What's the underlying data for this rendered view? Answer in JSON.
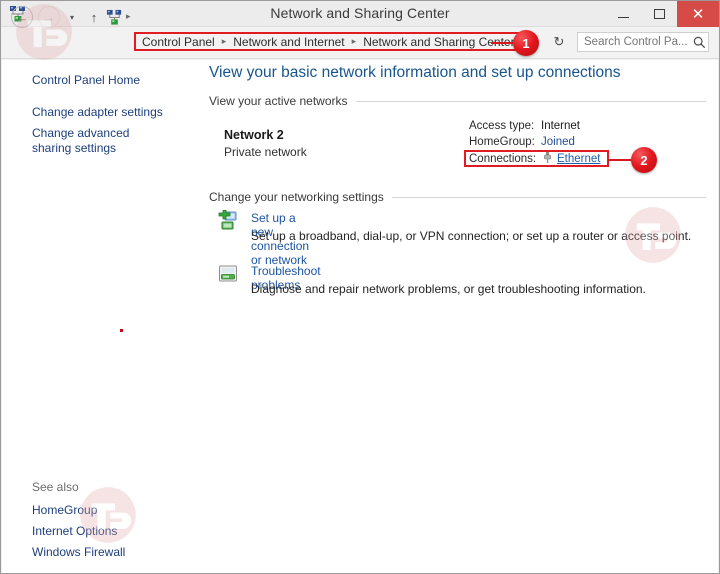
{
  "window": {
    "title": "Network and Sharing Center",
    "icon": "network-icon",
    "controls": {
      "minimize": "minimize-button",
      "maximize": "maximize-button",
      "close_label": "✕"
    }
  },
  "navbar": {
    "back_glyph": "←",
    "forward_glyph": "→",
    "history_glyph": "▾",
    "up_glyph": "↑",
    "first_sep": "▸",
    "breadcrumb": [
      "Control Panel",
      "Network and Internet",
      "Network and Sharing Center"
    ],
    "breadcrumb_sep": "▸",
    "refresh_glyph": "↻",
    "search": {
      "value": "",
      "placeholder": "Search Control Pa...",
      "icon": "search-icon"
    }
  },
  "annotations": [
    {
      "number": "1"
    },
    {
      "number": "2"
    }
  ],
  "sidebar": {
    "items": [
      {
        "label": "Control Panel Home"
      },
      {
        "label": "Change adapter settings"
      },
      {
        "label": "Change advanced sharing settings"
      }
    ],
    "see_also_label": "See also",
    "see_also": [
      {
        "label": "HomeGroup"
      },
      {
        "label": "Internet Options"
      },
      {
        "label": "Windows Firewall"
      }
    ]
  },
  "main": {
    "page_title": "View your basic network information and set up connections",
    "active_networks_heading": "View your active networks",
    "network": {
      "name": "Network  2",
      "type": "Private network",
      "info": [
        {
          "label": "Access type:",
          "value": "Internet",
          "is_link": false
        },
        {
          "label": "HomeGroup:",
          "value": "Joined",
          "is_link": true
        }
      ],
      "connections_label": "Connections:",
      "connection_name": "Ethernet",
      "connection_icon": "ethernet-plug-icon"
    },
    "change_settings_heading": "Change your networking settings",
    "tasks": [
      {
        "icon": "new-connection-icon",
        "link": "Set up a new connection or network",
        "desc": "Set up a broadband, dial-up, or VPN connection; or set up a router or access point."
      },
      {
        "icon": "troubleshoot-icon",
        "link": "Troubleshoot problems",
        "desc": "Diagnose and repair network problems, or get troubleshooting information."
      }
    ]
  },
  "colors": {
    "accent_link": "#1d54a0",
    "title_link": "#17558f",
    "annotation_red": "#e11b22",
    "close_red": "#d64b47"
  }
}
